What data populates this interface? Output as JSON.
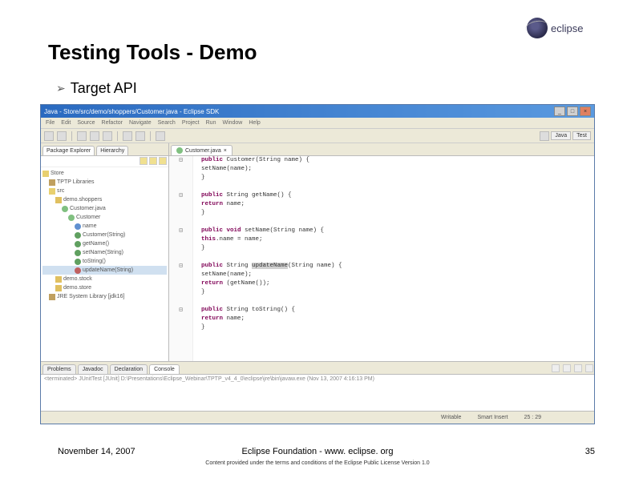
{
  "slide": {
    "title": "Testing Tools - Demo",
    "bullet": "Target API",
    "logo_text": "eclipse"
  },
  "ide": {
    "title": "Java - Store/src/demo/shoppers/Customer.java - Eclipse SDK",
    "menu": [
      "File",
      "Edit",
      "Source",
      "Refactor",
      "Navigate",
      "Search",
      "Project",
      "Run",
      "Window",
      "Help"
    ],
    "perspectives": {
      "java": "Java",
      "test": "Test"
    },
    "explorer": {
      "tab_active": "Package Explorer",
      "tab_other": "Hierarchy",
      "project": "Store",
      "lib": "TPTP Libraries",
      "src": "src",
      "pkg": "demo.shoppers",
      "file": "Customer.java",
      "class": "Customer",
      "field": "name",
      "ctor": "Customer(String)",
      "m_get": "getName()",
      "m_set": "setName(String)",
      "m_to": "toString()",
      "m_upd": "updateName(String)",
      "pkg2": "demo.stock",
      "pkg3": "demo.store",
      "jre": "JRE System Library [jdk16]"
    },
    "editor": {
      "tab": "Customer.java",
      "l1a": "public",
      "l1b": " Customer(String name) {",
      "l2": "    setName(name);",
      "l3": "}",
      "l4a": "public",
      "l4b": " String getName() {",
      "l5a": "    return",
      "l5b": " name;",
      "l6": "}",
      "l7a": "public void",
      "l7b": " setName(String name) {",
      "l8a": "    this",
      "l8b": ".name = name;",
      "l9": "}",
      "l10a": "public",
      "l10b": " String ",
      "l10c": "updateName",
      "l10d": "(String name) {",
      "l11": "    setName(name);",
      "l12a": "    return",
      "l12b": " (getName());",
      "l13": "}",
      "l14a": "public",
      "l14b": " String toString() {",
      "l15a": "    return",
      "l15b": " name;",
      "l16": "}"
    },
    "console": {
      "tab_problems": "Problems",
      "tab_javadoc": "Javadoc",
      "tab_decl": "Declaration",
      "tab_console": "Console",
      "status": "<terminated> JUnitTest [JUnit] D:\\Presentations\\Eclipse_Webinar\\TPTP_v4_4_0\\eclipse\\jre\\bin\\javaw.exe (Nov 13, 2007 4:16:13 PM)"
    },
    "status": {
      "writable": "Writable",
      "insert": "Smart Insert",
      "pos": "25 : 29"
    }
  },
  "footer": {
    "date": "November 14, 2007",
    "center": "Eclipse Foundation - www. eclipse. org",
    "sub": "Content provided under the terms and conditions of the Eclipse Public License Version 1.0",
    "page": "35"
  }
}
